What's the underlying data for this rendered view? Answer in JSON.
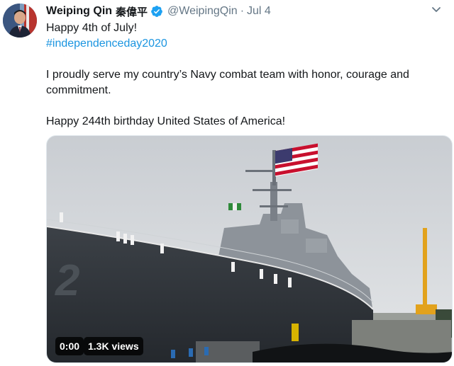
{
  "tweet": {
    "display_name": "Weiping Qin",
    "cjk_name": "秦偉平",
    "handle": "@WeipingQin",
    "separator": "·",
    "time": "Jul 4",
    "verified": true,
    "lines": {
      "line1": "Happy 4th of July!",
      "hashtag": "#independenceday2020",
      "line3": "I proudly serve my country’s Navy combat team with honor, courage and commitment.",
      "line4": "Happy 244th birthday United States of America!"
    }
  },
  "video": {
    "elapsed": "0:00",
    "views": "1.3K views",
    "hull_number": "2"
  },
  "icons": {
    "avatar": "profile-photo",
    "verified": "verified-badge-icon",
    "caret": "chevron-down-icon"
  },
  "colors": {
    "link": "#1b95e0",
    "verified": "#1da1f2",
    "secondary_text": "#657786"
  }
}
